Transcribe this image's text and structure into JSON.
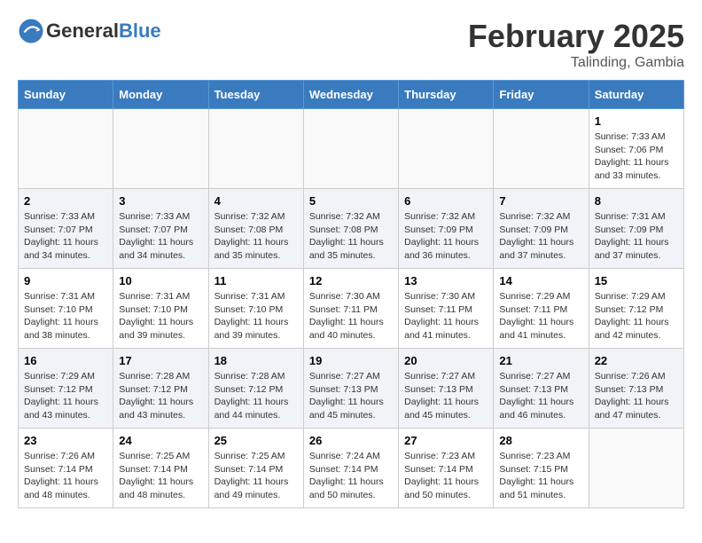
{
  "header": {
    "logo_general": "General",
    "logo_blue": "Blue",
    "month_year": "February 2025",
    "location": "Talinding, Gambia"
  },
  "weekdays": [
    "Sunday",
    "Monday",
    "Tuesday",
    "Wednesday",
    "Thursday",
    "Friday",
    "Saturday"
  ],
  "weeks": [
    [
      {
        "day": "",
        "info": ""
      },
      {
        "day": "",
        "info": ""
      },
      {
        "day": "",
        "info": ""
      },
      {
        "day": "",
        "info": ""
      },
      {
        "day": "",
        "info": ""
      },
      {
        "day": "",
        "info": ""
      },
      {
        "day": "1",
        "info": "Sunrise: 7:33 AM\nSunset: 7:06 PM\nDaylight: 11 hours\nand 33 minutes."
      }
    ],
    [
      {
        "day": "2",
        "info": "Sunrise: 7:33 AM\nSunset: 7:07 PM\nDaylight: 11 hours\nand 34 minutes."
      },
      {
        "day": "3",
        "info": "Sunrise: 7:33 AM\nSunset: 7:07 PM\nDaylight: 11 hours\nand 34 minutes."
      },
      {
        "day": "4",
        "info": "Sunrise: 7:32 AM\nSunset: 7:08 PM\nDaylight: 11 hours\nand 35 minutes."
      },
      {
        "day": "5",
        "info": "Sunrise: 7:32 AM\nSunset: 7:08 PM\nDaylight: 11 hours\nand 35 minutes."
      },
      {
        "day": "6",
        "info": "Sunrise: 7:32 AM\nSunset: 7:09 PM\nDaylight: 11 hours\nand 36 minutes."
      },
      {
        "day": "7",
        "info": "Sunrise: 7:32 AM\nSunset: 7:09 PM\nDaylight: 11 hours\nand 37 minutes."
      },
      {
        "day": "8",
        "info": "Sunrise: 7:31 AM\nSunset: 7:09 PM\nDaylight: 11 hours\nand 37 minutes."
      }
    ],
    [
      {
        "day": "9",
        "info": "Sunrise: 7:31 AM\nSunset: 7:10 PM\nDaylight: 11 hours\nand 38 minutes."
      },
      {
        "day": "10",
        "info": "Sunrise: 7:31 AM\nSunset: 7:10 PM\nDaylight: 11 hours\nand 39 minutes."
      },
      {
        "day": "11",
        "info": "Sunrise: 7:31 AM\nSunset: 7:10 PM\nDaylight: 11 hours\nand 39 minutes."
      },
      {
        "day": "12",
        "info": "Sunrise: 7:30 AM\nSunset: 7:11 PM\nDaylight: 11 hours\nand 40 minutes."
      },
      {
        "day": "13",
        "info": "Sunrise: 7:30 AM\nSunset: 7:11 PM\nDaylight: 11 hours\nand 41 minutes."
      },
      {
        "day": "14",
        "info": "Sunrise: 7:29 AM\nSunset: 7:11 PM\nDaylight: 11 hours\nand 41 minutes."
      },
      {
        "day": "15",
        "info": "Sunrise: 7:29 AM\nSunset: 7:12 PM\nDaylight: 11 hours\nand 42 minutes."
      }
    ],
    [
      {
        "day": "16",
        "info": "Sunrise: 7:29 AM\nSunset: 7:12 PM\nDaylight: 11 hours\nand 43 minutes."
      },
      {
        "day": "17",
        "info": "Sunrise: 7:28 AM\nSunset: 7:12 PM\nDaylight: 11 hours\nand 43 minutes."
      },
      {
        "day": "18",
        "info": "Sunrise: 7:28 AM\nSunset: 7:12 PM\nDaylight: 11 hours\nand 44 minutes."
      },
      {
        "day": "19",
        "info": "Sunrise: 7:27 AM\nSunset: 7:13 PM\nDaylight: 11 hours\nand 45 minutes."
      },
      {
        "day": "20",
        "info": "Sunrise: 7:27 AM\nSunset: 7:13 PM\nDaylight: 11 hours\nand 45 minutes."
      },
      {
        "day": "21",
        "info": "Sunrise: 7:27 AM\nSunset: 7:13 PM\nDaylight: 11 hours\nand 46 minutes."
      },
      {
        "day": "22",
        "info": "Sunrise: 7:26 AM\nSunset: 7:13 PM\nDaylight: 11 hours\nand 47 minutes."
      }
    ],
    [
      {
        "day": "23",
        "info": "Sunrise: 7:26 AM\nSunset: 7:14 PM\nDaylight: 11 hours\nand 48 minutes."
      },
      {
        "day": "24",
        "info": "Sunrise: 7:25 AM\nSunset: 7:14 PM\nDaylight: 11 hours\nand 48 minutes."
      },
      {
        "day": "25",
        "info": "Sunrise: 7:25 AM\nSunset: 7:14 PM\nDaylight: 11 hours\nand 49 minutes."
      },
      {
        "day": "26",
        "info": "Sunrise: 7:24 AM\nSunset: 7:14 PM\nDaylight: 11 hours\nand 50 minutes."
      },
      {
        "day": "27",
        "info": "Sunrise: 7:23 AM\nSunset: 7:14 PM\nDaylight: 11 hours\nand 50 minutes."
      },
      {
        "day": "28",
        "info": "Sunrise: 7:23 AM\nSunset: 7:15 PM\nDaylight: 11 hours\nand 51 minutes."
      },
      {
        "day": "",
        "info": ""
      }
    ]
  ]
}
